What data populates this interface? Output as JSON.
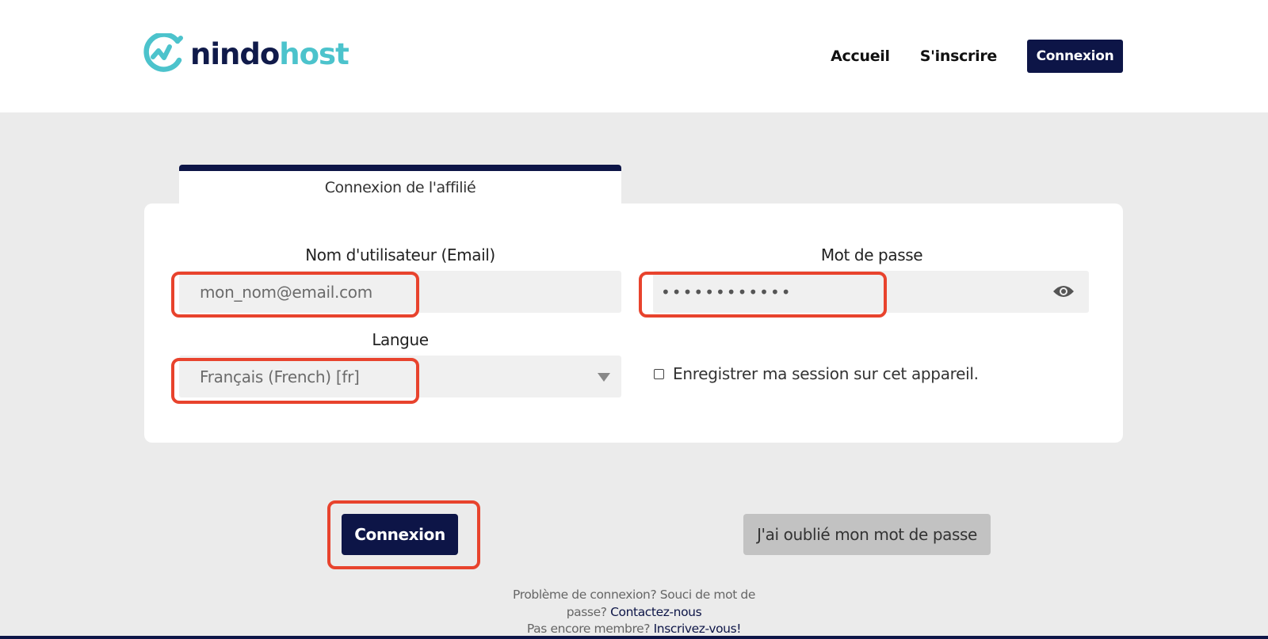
{
  "header": {
    "logo_part1": "nindo",
    "logo_part2": "host",
    "nav": {
      "home": "Accueil",
      "signup": "S'inscrire",
      "login": "Connexion"
    }
  },
  "tab": {
    "label": "Connexion de l'affilié"
  },
  "form": {
    "username_label": "Nom d'utilisateur (Email)",
    "username_value": "mon_nom@email.com",
    "password_label": "Mot de passe",
    "password_value": "••••••••••••",
    "language_label": "Langue",
    "language_value": "Français (French) [fr]",
    "remember_label": "Enregistrer ma session sur cet appareil."
  },
  "buttons": {
    "login": "Connexion",
    "forgot": "J'ai oublié mon mot de passe"
  },
  "help": {
    "problem_text": "Problème de connexion? Souci de mot de passe?",
    "contact_link": "Contactez-nous",
    "not_member_text": "Pas encore membre?",
    "signup_link": "Inscrivez-vous!"
  },
  "colors": {
    "brand_dark": "#0d1547",
    "brand_teal": "#4cc3cc",
    "highlight": "#e8432d"
  },
  "icons": {
    "logo": "nindohost-logo-icon",
    "password_toggle": "eye-icon",
    "dropdown": "caret-down-icon"
  }
}
